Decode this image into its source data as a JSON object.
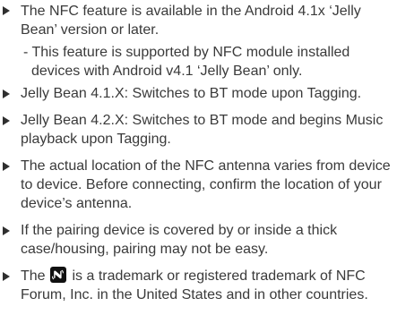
{
  "notes": [
    {
      "text": "The NFC feature is available in the Android 4.1x ‘Jelly Bean’ version or later.",
      "sub": "- This feature is supported by NFC module installed devices with Android v4.1 ‘Jelly Bean’ only."
    },
    {
      "text": "Jelly Bean 4.1.X: Switches to BT mode upon Tagging."
    },
    {
      "text": "Jelly Bean 4.2.X: Switches to BT mode and begins Music playback upon Tagging."
    },
    {
      "text": "The actual location of the NFC antenna varies from device to device. Before connecting, confirm the location of your device’s antenna."
    },
    {
      "text": "If the pairing device is covered by or inside a thick case/housing, pairing may not be easy."
    },
    {
      "text_before_logo": "The",
      "logo_icon": "nfc-n-mark-icon",
      "text_after_logo": "is a trademark or registered trademark of NFC Forum, Inc. in the United States and in other countries."
    }
  ],
  "colors": {
    "text": "#3a3a3a",
    "bullet": "#2f2f2f",
    "logo": "#111111"
  }
}
